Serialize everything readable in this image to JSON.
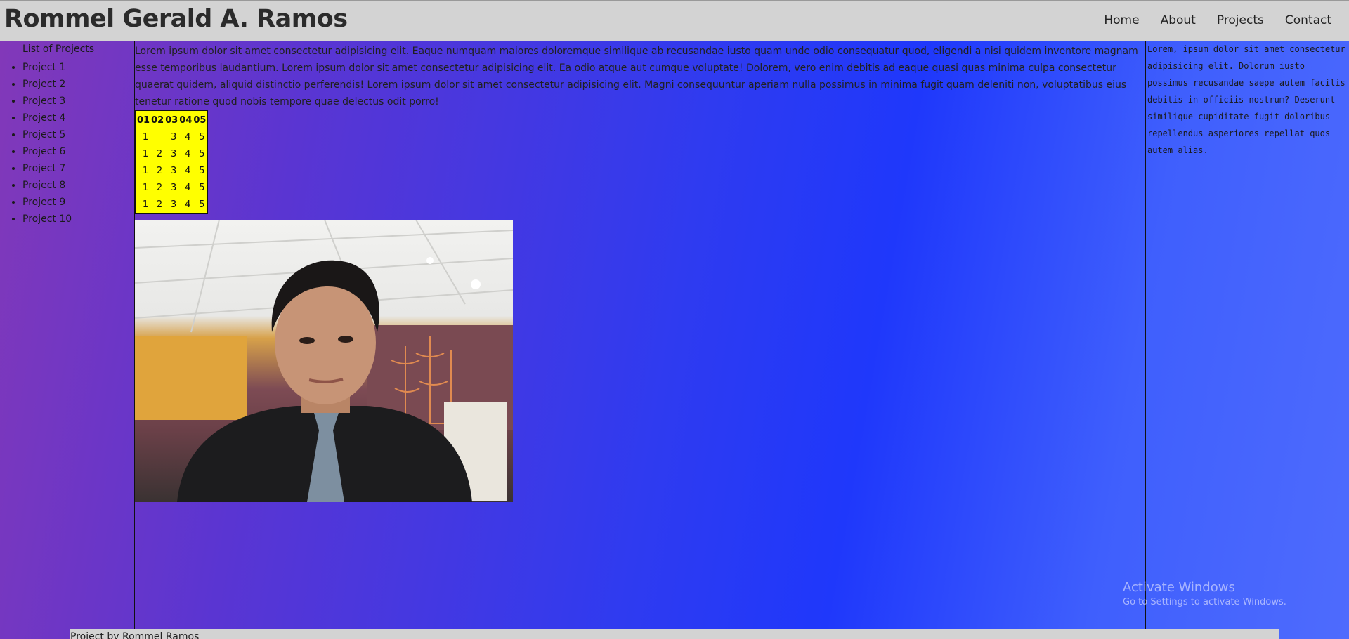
{
  "header": {
    "title": "Rommel Gerald A. Ramos",
    "nav": [
      "Home",
      "About",
      "Projects",
      "Contact"
    ]
  },
  "sidebar": {
    "heading": "List of Projects",
    "items": [
      "Project 1",
      "Project 2",
      "Project 3",
      "Project 4",
      "Project 5",
      "Project 6",
      "Project 7",
      "Project 8",
      "Project 9",
      "Project 10"
    ]
  },
  "main": {
    "intro": "Lorem ipsum dolor sit amet consectetur adipisicing elit. Eaque numquam maiores doloremque similique ab recusandae iusto quam unde odio consequatur quod, eligendi a nisi quidem inventore magnam esse temporibus laudantium. Lorem ipsum dolor sit amet consectetur adipisicing elit. Ea odio atque aut cumque voluptate! Dolorem, vero enim debitis ad eaque quasi quas minima culpa consectetur quaerat quidem, aliquid distinctio perferendis! Lorem ipsum dolor sit amet consectetur adipisicing elit. Magni consequuntur aperiam nulla possimus in minima fugit quam deleniti non, voluptatibus eius tenetur ratione quod nobis tempore quae delectus odit porro!",
    "table": {
      "headers": [
        "01",
        "02",
        "03",
        "04",
        "05"
      ],
      "rows": [
        [
          "1",
          "",
          "3",
          "4",
          "5"
        ],
        [
          "1",
          "2",
          "3",
          "4",
          "5"
        ],
        [
          "1",
          "2",
          "3",
          "4",
          "5"
        ],
        [
          "1",
          "2",
          "3",
          "4",
          "5"
        ],
        [
          "1",
          "2",
          "3",
          "4",
          "5"
        ]
      ]
    }
  },
  "aside": {
    "text": "Lorem, ipsum dolor sit amet consectetur adipisicing elit. Dolorum iusto possimus recusandae saepe autem facilis debitis in officiis nostrum? Deserunt similique cupiditate fugit doloribus repellendus asperiores repellat quos autem alias."
  },
  "watermark": {
    "title": "Activate Windows",
    "subtitle": "Go to Settings to activate Windows."
  },
  "footer": {
    "text": "Project by Rommel Ramos"
  },
  "colors": {
    "header_bg": "#d3d3d3",
    "table_bg": "#ffff00",
    "gradient_start": "#8338b8",
    "gradient_mid": "#1f38fb",
    "gradient_end": "#4e6bfd"
  }
}
